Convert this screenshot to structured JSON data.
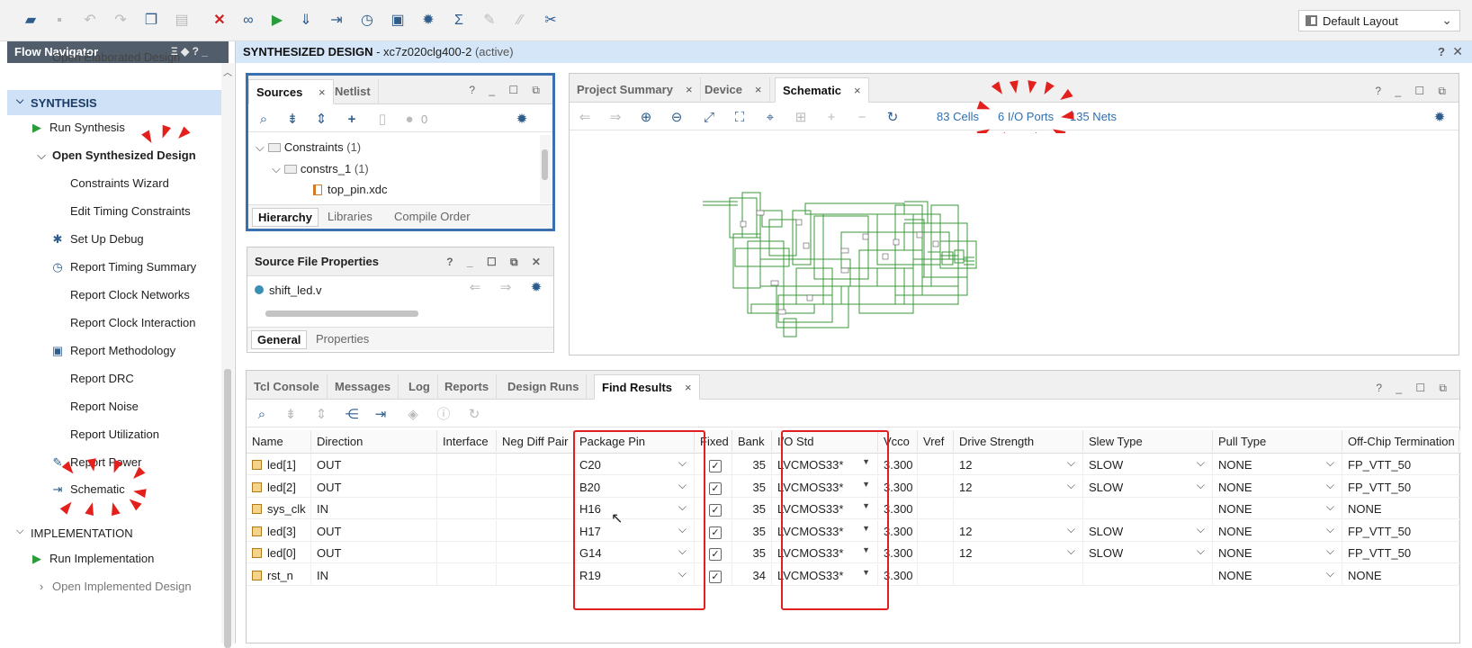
{
  "toolbar": {
    "icons": [
      "open-project-icon",
      "save-icon",
      "undo-icon",
      "redo-icon",
      "copy-icon",
      "paste-icon",
      "delete-icon",
      "binoculars-icon",
      "run-icon",
      "program-icon",
      "schematic-icon",
      "timer-icon",
      "checklist-icon",
      "gear-icon",
      "sigma-icon",
      "tool-a-icon",
      "tool-b-icon",
      "tool-c-icon"
    ],
    "layout_select": "Default Layout"
  },
  "flow_navigator": {
    "title": "Flow Navigator",
    "header_controls": "Ξ ◆ ? _",
    "partial_item": "Open Elaborated Design",
    "synthesis_label": "SYNTHESIS",
    "run_synthesis": "Run Synthesis",
    "open_synth_design": "Open Synthesized Design",
    "items": [
      "Constraints Wizard",
      "Edit Timing Constraints",
      "Set Up Debug",
      "Report Timing Summary",
      "Report Clock Networks",
      "Report Clock Interaction",
      "Report Methodology",
      "Report DRC",
      "Report Noise",
      "Report Utilization",
      "Report Power",
      "Schematic"
    ],
    "implementation_label": "IMPLEMENTATION",
    "run_implementation": "Run Implementation",
    "open_impl_design": "Open Implemented Design"
  },
  "main_header": {
    "title": "SYNTHESIZED DESIGN",
    "part": "- xc7z020clg400-2",
    "status": "(active)"
  },
  "sources": {
    "tab_sources": "Sources",
    "tab_netlist": "Netlist",
    "close": "×",
    "count": "0",
    "tree": {
      "constraints": "Constraints",
      "constraints_count": "(1)",
      "constrs": "constrs_1",
      "constrs_count": "(1)",
      "file": "top_pin.xdc"
    },
    "subtabs": [
      "Hierarchy",
      "Libraries",
      "Compile Order"
    ]
  },
  "source_props": {
    "title": "Source File Properties",
    "file": "shift_led.v",
    "subtabs": [
      "General",
      "Properties"
    ]
  },
  "schematic_panel": {
    "tabs": [
      "Project Summary",
      "Device",
      "Schematic"
    ],
    "cells": "83 Cells",
    "io_ports": "6 I/O Ports",
    "nets": "135 Nets"
  },
  "bottom_panel": {
    "tabs": [
      "Tcl Console",
      "Messages",
      "Log",
      "Reports",
      "Design Runs",
      "Find Results"
    ],
    "columns": [
      "Name",
      "Direction",
      "Interface",
      "Neg Diff Pair",
      "Package Pin",
      "Fixed",
      "Bank",
      "I/O Std",
      "Vcco",
      "Vref",
      "Drive Strength",
      "Slew Type",
      "Pull Type",
      "Off-Chip Termination"
    ],
    "rows": [
      {
        "name": "led[1]",
        "direction": "OUT",
        "pin": "C20",
        "bank": "35",
        "iostd": "LVCMOS33*",
        "vcco": "3.300",
        "drive": "12",
        "slew": "SLOW",
        "pull": "NONE",
        "term": "FP_VTT_50"
      },
      {
        "name": "led[2]",
        "direction": "OUT",
        "pin": "B20",
        "bank": "35",
        "iostd": "LVCMOS33*",
        "vcco": "3.300",
        "drive": "12",
        "slew": "SLOW",
        "pull": "NONE",
        "term": "FP_VTT_50"
      },
      {
        "name": "sys_clk",
        "direction": "IN",
        "pin": "H16",
        "bank": "35",
        "iostd": "LVCMOS33*",
        "vcco": "3.300",
        "drive": "",
        "slew": "",
        "pull": "NONE",
        "term": "NONE"
      },
      {
        "name": "led[3]",
        "direction": "OUT",
        "pin": "H17",
        "bank": "35",
        "iostd": "LVCMOS33*",
        "vcco": "3.300",
        "drive": "12",
        "slew": "SLOW",
        "pull": "NONE",
        "term": "FP_VTT_50"
      },
      {
        "name": "led[0]",
        "direction": "OUT",
        "pin": "G14",
        "bank": "35",
        "iostd": "LVCMOS33*",
        "vcco": "3.300",
        "drive": "12",
        "slew": "SLOW",
        "pull": "NONE",
        "term": "FP_VTT_50"
      },
      {
        "name": "rst_n",
        "direction": "IN",
        "pin": "R19",
        "bank": "34",
        "iostd": "LVCMOS33*",
        "vcco": "3.300",
        "drive": "",
        "slew": "",
        "pull": "NONE",
        "term": "NONE"
      }
    ]
  },
  "colors": {
    "accent": "#2f6fb3",
    "annotation": "#e3201b",
    "selection": "#cfe1f7",
    "schematic": "#3a9a3a"
  }
}
